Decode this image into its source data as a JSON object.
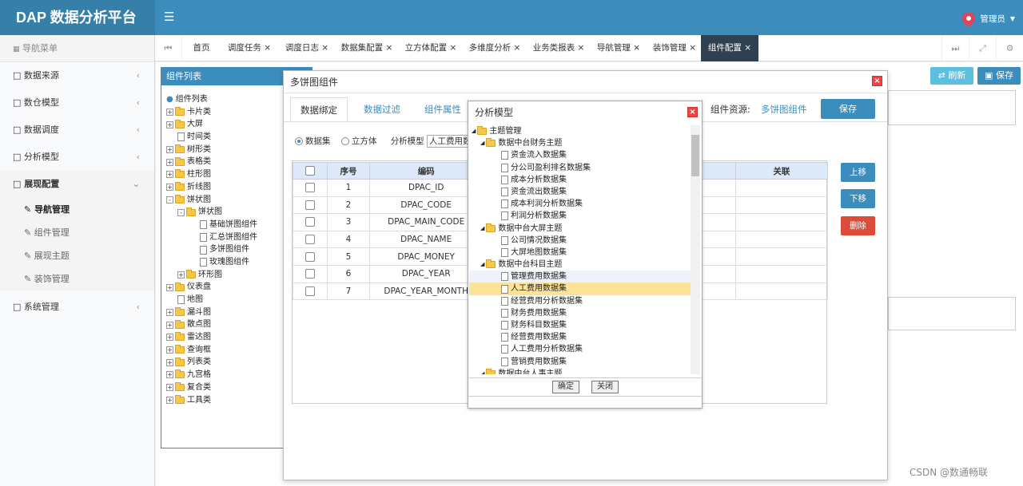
{
  "header": {
    "app_title": "DAP 数据分析平台",
    "user": "管理员"
  },
  "sidebar": {
    "title": "导航菜单",
    "items": [
      {
        "label": "数据来源"
      },
      {
        "label": "数仓模型"
      },
      {
        "label": "数据调度"
      },
      {
        "label": "分析模型"
      },
      {
        "label": "展现配置"
      },
      {
        "label": "系统管理"
      }
    ],
    "subitems": [
      {
        "label": "导航管理"
      },
      {
        "label": "组件管理"
      },
      {
        "label": "展现主题"
      },
      {
        "label": "装饰管理"
      }
    ]
  },
  "tabs": [
    {
      "label": "首页"
    },
    {
      "label": "调度任务"
    },
    {
      "label": "调度日志"
    },
    {
      "label": "数据集配置"
    },
    {
      "label": "立方体配置"
    },
    {
      "label": "多维度分析"
    },
    {
      "label": "业务类报表"
    },
    {
      "label": "导航管理"
    },
    {
      "label": "装饰管理"
    },
    {
      "label": "组件配置"
    }
  ],
  "toolbar": {
    "refresh_label": "刷新",
    "save_label": "保存"
  },
  "component_list": {
    "title": "组件列表",
    "root": "组件列表",
    "nodes": [
      "卡片类",
      "大屏",
      "时间类",
      "树形类",
      "表格类",
      "柱形图",
      "折线图",
      "饼状图",
      "饼状图",
      "基础饼图组件",
      "汇总饼图组件",
      "多饼图组件",
      "玫瑰图组件",
      "环形图",
      "仪表盘",
      "地图",
      "漏斗图",
      "散点图",
      "雷达图",
      "查询框",
      "列表类",
      "九宫格",
      "复合类",
      "工具类"
    ]
  },
  "modal": {
    "title": "多饼图组件",
    "tabs": [
      "数据绑定",
      "数据过滤",
      "组件属性"
    ],
    "resource_label": "组件资源:",
    "resource_value": "多饼图组件",
    "save_label": "保存",
    "radio_dataset": "数据集",
    "radio_cube": "立方体",
    "model_label": "分析模型",
    "model_value": "人工费用数据集",
    "columns": {
      "seq": "序号",
      "code": "编码",
      "relation": "关联"
    },
    "rows": [
      {
        "seq": "1",
        "code": "DPAC_ID"
      },
      {
        "seq": "2",
        "code": "DPAC_CODE"
      },
      {
        "seq": "3",
        "code": "DPAC_MAIN_CODE"
      },
      {
        "seq": "4",
        "code": "DPAC_NAME"
      },
      {
        "seq": "5",
        "code": "DPAC_MONEY"
      },
      {
        "seq": "6",
        "code": "DPAC_YEAR"
      },
      {
        "seq": "7",
        "code": "DPAC_YEAR_MONTH"
      }
    ],
    "btn_up": "上移",
    "btn_down": "下移",
    "btn_delete": "删除"
  },
  "dialog": {
    "title": "分析模型",
    "tree": [
      "主题管理",
      "数据中台财务主题",
      "资金流入数据集",
      "分公司盈利排名数据集",
      "成本分析数据集",
      "资金流出数据集",
      "成本利润分析数据集",
      "利润分析数据集",
      "数据中台大屏主题",
      "公司情况数据集",
      "大屏地图数据集",
      "数据中台科目主题",
      "管理费用数据集",
      "人工费用数据集",
      "经营费用分析数据集",
      "财务费用数据集",
      "财务科目数据集",
      "经营费用数据集",
      "人工费用分析数据集",
      "营销费用数据集",
      "数据中台人事主题"
    ],
    "ok_label": "确定",
    "close_label": "关闭"
  },
  "watermark": "CSDN @数通畅联"
}
